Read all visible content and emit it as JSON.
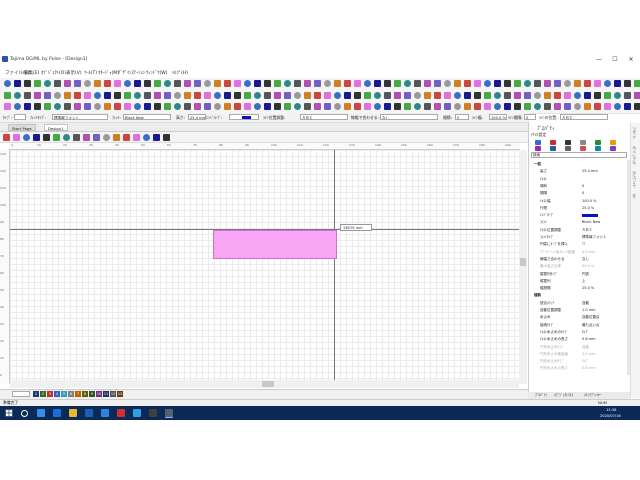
{
  "window": {
    "title": "Tajima DG/ML by Pulse - [Design1]",
    "controls": [
      "—",
      "☐",
      "✕"
    ]
  },
  "menubar": {
    "items": [
      "ファイル(F)",
      "編集(E)",
      "ｵﾌﾞｼﾞｪｸﾄ(O)",
      "表示(V)",
      "ﾂｰﾙ(T)",
      "ﾏﾈｰｼﾞｬ(M)",
      "ﾃﾞｻﾞｲﾝｽﾃｰｼｮﾝ",
      "ｳｨﾝﾄﾞｳ(W)",
      "ﾍﾙﾌﾟ(H)"
    ]
  },
  "property_bar": {
    "type_label": "ﾀｲﾌﾟ:",
    "font_type_label": "ﾌｫﾝﾄﾀｲﾌﾟ:",
    "font_type_value": "標準線フォント",
    "font_label": "ﾌｫﾝﾄ:",
    "font_value": "Block New",
    "height_label": "高さ:",
    "height_value": "25.4 mm",
    "envelope_label": "ｴﾝﾍﾞﾛｰﾌﾟ:",
    "line_pos_label": "ﾗｲﾝ位置調整:",
    "line_pos_value": "ＡＢＣ",
    "fit_label": "線幅で合わせる:",
    "fit_value": "なし",
    "spacing_label": "間隔:",
    "spacing_value": "0",
    "width_label": "ﾗｲﾝ幅:",
    "width_value": "100.0 %",
    "line_spacing_label": "ﾗｲﾝ間隔:",
    "line_spacing_value": "0",
    "text_pos_label": "ﾗｲﾝの位置:",
    "text_pos_value": "ＡＢＣ"
  },
  "tabs": [
    {
      "label": "Start Page",
      "active": false
    },
    {
      "label": "Design1",
      "active": true
    }
  ],
  "ruler": {
    "h_ticks": [
      "0",
      "10",
      "20",
      "30",
      "40",
      "50",
      "60",
      "70",
      "80",
      "90",
      "100",
      "110",
      "120",
      "130",
      "140",
      "150",
      "160",
      "170",
      "180",
      "190"
    ],
    "v_ticks": [
      "130",
      "120",
      "110",
      "100",
      "90",
      "80",
      "70",
      "60",
      "50",
      "40",
      "30",
      "20",
      "10",
      "0"
    ]
  },
  "canvas": {
    "tooltip": "136.91 mm"
  },
  "page_numbers": [
    "1",
    "2",
    "3",
    "4",
    "5",
    "6",
    "7",
    "8",
    "9",
    "10",
    "11",
    "12",
    "13"
  ],
  "page_colors": [
    "#1e3c78",
    "#2e6b2e",
    "#c03030",
    "#3060c0",
    "#30a0c0",
    "#808080",
    "#c06000",
    "#606000",
    "#305030",
    "#7a2a7a",
    "#203060",
    "#505050",
    "#6a3a1a"
  ],
  "right_panel": {
    "title": "ﾌﾟﾛﾊﾟﾃｨ",
    "subtitle": "ﾃｷｽﾄ設定",
    "search_placeholder": "検索",
    "rows": [
      {
        "label": "一般",
        "value": "",
        "section": true
      },
      {
        "label": "高さ",
        "value": "25.4 mm"
      },
      {
        "label": "ﾃｷｽﾄ",
        "value": ""
      },
      {
        "label": "傾斜",
        "value": "0"
      },
      {
        "label": "間隔",
        "value": "0"
      },
      {
        "label": "ﾃｷｽﾄ幅",
        "value": "100.0 %"
      },
      {
        "label": "行間",
        "value": "25.0 %"
      },
      {
        "label": "ｴﾝﾍﾞﾛｰﾌﾟ",
        "value": ""
      },
      {
        "label": "ﾌｫﾝﾄ",
        "value": "Block New"
      },
      {
        "label": "ﾃｷｽﾄ位置調整",
        "value": "ＡＢＣ"
      },
      {
        "label": "ﾌｫﾝﾄﾀｲﾌﾟ",
        "value": "標準線フォント"
      },
      {
        "label": "円弧にｶｰﾌﾞを挿入",
        "value": "☐"
      },
      {
        "label": "ｱﾌﾟﾘｹｰｼｮﾝ後ｽﾃｨｯﾁ距離",
        "value": "4.0 mm",
        "grey": true
      },
      {
        "label": "線幅で合わせる",
        "value": "なし"
      },
      {
        "label": "最大高さ比率",
        "value": "50.0 %",
        "grey": true
      },
      {
        "label": "縦整列ﾀｲﾌﾟ",
        "value": "円弧"
      },
      {
        "label": "縦整列",
        "value": "上"
      },
      {
        "label": "縦間隔",
        "value": "25.0 %"
      },
      {
        "label": "縫製",
        "value": "",
        "section": true
      },
      {
        "label": "縫合ｽﾃｯﾁ",
        "value": "自動"
      },
      {
        "label": "自動位置調整",
        "value": "1.0 mm"
      },
      {
        "label": "糸止め",
        "value": "自動位置合"
      },
      {
        "label": "接続ﾀｲﾌﾟ",
        "value": "最も近い点"
      },
      {
        "label": "ﾃｷｽﾄ糸止めのﾀｲﾌﾟ",
        "value": "ﾀｲﾌﾟ"
      },
      {
        "label": "ﾃｷｽﾄ糸止めの長さ",
        "value": "0.8 mm"
      },
      {
        "label": "円形糸止めﾀｲﾌﾟ",
        "value": "自動",
        "grey": true
      },
      {
        "label": "円形糸止め最高値",
        "value": "3.0 mm",
        "grey": true
      },
      {
        "label": "円形糸止めﾀｲﾌﾟ",
        "value": "ﾀｲﾌﾟ",
        "grey": true
      },
      {
        "label": "円形糸止めの長さ",
        "value": "0.8 mm",
        "grey": true
      }
    ],
    "bottom_tabs": [
      "ﾌﾟﾛﾊﾟﾃｨ",
      "ｵﾌﾞｼﾞｪｸﾄﾘｽﾄ",
      "ｽﾃｯﾁﾌﾟﾚｲﾔｰ"
    ]
  },
  "side_strip": [
    "ﾌﾟﾛﾊﾟﾃｨ",
    "ｵﾌﾞｼﾞｪｸﾄﾘｽﾄ",
    "ｽﾃｯﾁﾌﾟﾚｲﾔｰ",
    "ｶﾗｰ"
  ],
  "status": {
    "left": "準備完了",
    "right": "NUM"
  },
  "taskbar": {
    "time": "13:36",
    "date": "2020/07/16"
  }
}
